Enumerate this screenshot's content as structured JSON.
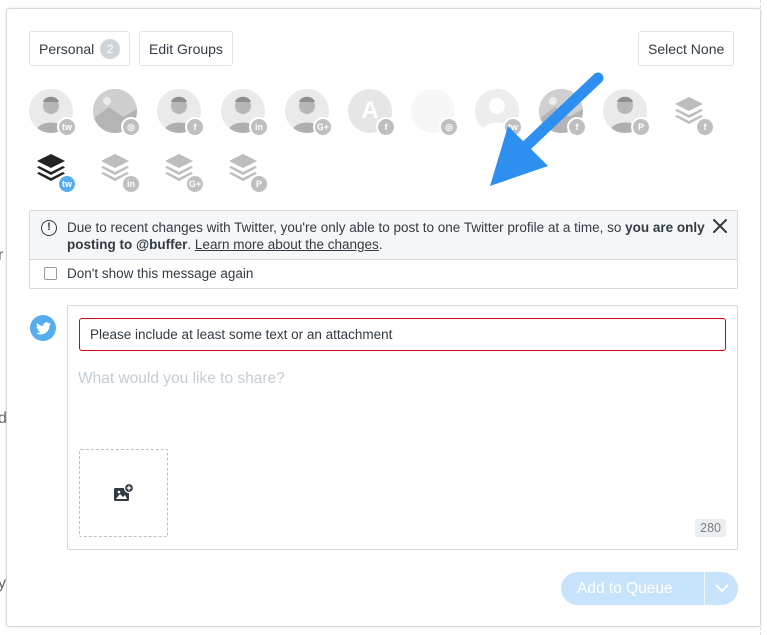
{
  "header": {
    "personal_label": "Personal",
    "personal_count": "2",
    "edit_groups_label": "Edit Groups",
    "select_none_label": "Select None"
  },
  "profiles": [
    {
      "network": "twitter",
      "kind": "person",
      "selected": false
    },
    {
      "network": "instagram",
      "kind": "photo",
      "selected": false
    },
    {
      "network": "facebook",
      "kind": "person",
      "selected": false
    },
    {
      "network": "linkedin",
      "kind": "person",
      "selected": false
    },
    {
      "network": "google-plus",
      "kind": "person",
      "selected": false
    },
    {
      "network": "facebook",
      "kind": "letter",
      "letter": "A",
      "selected": false
    },
    {
      "network": "instagram",
      "kind": "blank",
      "selected": false
    },
    {
      "network": "twitter",
      "kind": "silhouette",
      "selected": false
    },
    {
      "network": "facebook",
      "kind": "photo",
      "selected": false
    },
    {
      "network": "pinterest",
      "kind": "group-photo",
      "selected": false
    },
    {
      "network": "facebook",
      "kind": "buffer-logo",
      "selected": false
    },
    {
      "network": "twitter",
      "kind": "buffer-logo",
      "selected": true
    },
    {
      "network": "linkedin",
      "kind": "buffer-logo",
      "selected": false
    },
    {
      "network": "google-plus",
      "kind": "buffer-logo",
      "selected": false
    },
    {
      "network": "pinterest",
      "kind": "buffer-logo",
      "selected": false
    }
  ],
  "notice": {
    "text_part1": "Due to recent changes with Twitter, you're only able to post to one Twitter profile at a time, so ",
    "text_bold": "you are only posting to @buffer",
    "text_part2": ". ",
    "link": "Learn more about the changes",
    "text_end": ".",
    "checkbox_label": "Don't show this message again",
    "checked": false
  },
  "composer": {
    "error": "Please include at least some text or an attachment",
    "placeholder": "What would you like to share?",
    "char_count": "280"
  },
  "footer": {
    "add_to_queue_label": "Add to Queue"
  },
  "background": {
    "fragments": [
      "r",
      "d",
      "y"
    ]
  },
  "colors": {
    "twitter": "#55acee",
    "instagram": "#8a8a8a",
    "facebook": "#3b5998",
    "linkedin": "#0077b5",
    "google-plus": "#dd4b39",
    "pinterest": "#cb2027",
    "accent": "#168eea",
    "error": "#d0021b"
  }
}
